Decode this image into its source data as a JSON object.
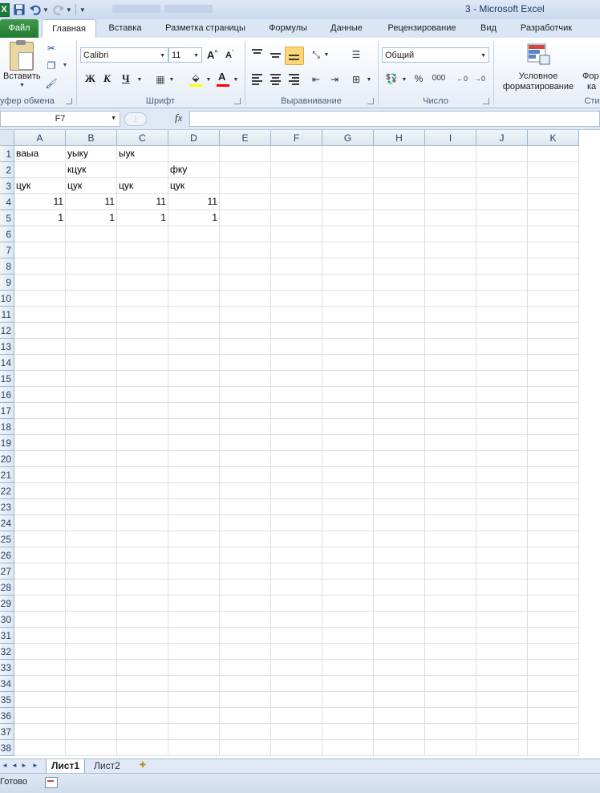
{
  "window": {
    "title": "3  -  Microsoft Excel"
  },
  "quick_access": {
    "icons": [
      "excel-logo",
      "save-icon",
      "undo-icon",
      "redo-icon",
      "customize-qat-icon"
    ]
  },
  "tabs": [
    {
      "label": "Файл"
    },
    {
      "label": "Главная"
    },
    {
      "label": "Вставка"
    },
    {
      "label": "Разметка страницы"
    },
    {
      "label": "Формулы"
    },
    {
      "label": "Данные"
    },
    {
      "label": "Рецензирование"
    },
    {
      "label": "Вид"
    },
    {
      "label": "Разработчик"
    }
  ],
  "ribbon": {
    "clipboard": {
      "paste_label": "Вставить",
      "group_label": "уфер обмена"
    },
    "font": {
      "font_name": "Calibri",
      "font_size": "11",
      "bold": "Ж",
      "italic": "К",
      "underline": "Ч",
      "group_label": "Шрифт",
      "fill_color": "#ffff00",
      "text_color": "#ff0000"
    },
    "alignment": {
      "group_label": "Выравнивание"
    },
    "number": {
      "format": "Общий",
      "percent": "%",
      "thousands": "000",
      "group_label": "Число"
    },
    "styles": {
      "conditional_label_1": "Условное",
      "conditional_label_2": "форматирование",
      "format_label_1": "Фор",
      "format_label_2": "ка",
      "group_label": "Стил"
    }
  },
  "formula_bar": {
    "name_box": "F7",
    "fx": "fx",
    "formula": ""
  },
  "grid": {
    "columns": [
      "A",
      "B",
      "C",
      "D",
      "E",
      "F",
      "G",
      "H",
      "I",
      "J",
      "K"
    ],
    "rows": [
      "1",
      "2",
      "3",
      "4",
      "5",
      "6",
      "7",
      "8",
      "9",
      "10",
      "11",
      "12",
      "13",
      "14",
      "15",
      "16",
      "17",
      "18",
      "19",
      "20",
      "21",
      "22",
      "23",
      "24",
      "25",
      "26",
      "27",
      "28",
      "29",
      "30",
      "31",
      "32",
      "33",
      "34",
      "35",
      "36",
      "37",
      "38"
    ],
    "cells": [
      {
        "ref": "A1",
        "value": "ваыа",
        "type": "text"
      },
      {
        "ref": "B1",
        "value": "уыку",
        "type": "text"
      },
      {
        "ref": "C1",
        "value": "ыук",
        "type": "text"
      },
      {
        "ref": "B2",
        "value": "кцук",
        "type": "text"
      },
      {
        "ref": "D2",
        "value": "фку",
        "type": "text"
      },
      {
        "ref": "A3",
        "value": "цук",
        "type": "text"
      },
      {
        "ref": "B3",
        "value": "цук",
        "type": "text"
      },
      {
        "ref": "C3",
        "value": "цук",
        "type": "text"
      },
      {
        "ref": "D3",
        "value": "цук",
        "type": "text"
      },
      {
        "ref": "A4",
        "value": "11",
        "type": "num"
      },
      {
        "ref": "B4",
        "value": "11",
        "type": "num"
      },
      {
        "ref": "C4",
        "value": "11",
        "type": "num"
      },
      {
        "ref": "D4",
        "value": "11",
        "type": "num"
      },
      {
        "ref": "A5",
        "value": "1",
        "type": "num"
      },
      {
        "ref": "B5",
        "value": "1",
        "type": "num"
      },
      {
        "ref": "C5",
        "value": "1",
        "type": "num"
      },
      {
        "ref": "D5",
        "value": "1",
        "type": "num"
      }
    ]
  },
  "sheets": [
    {
      "label": "Лист1",
      "active": true
    },
    {
      "label": "Лист2",
      "active": false
    }
  ],
  "status": {
    "text": "Готово"
  }
}
